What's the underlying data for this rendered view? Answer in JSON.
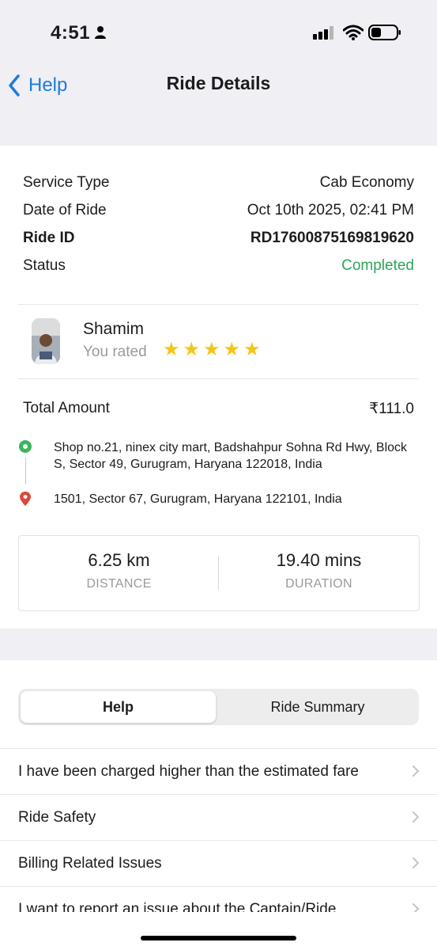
{
  "status_bar": {
    "time": "4:51"
  },
  "nav": {
    "back_label": "Help",
    "title": "Ride Details"
  },
  "ride": {
    "service_type_label": "Service Type",
    "service_type_value": "Cab Economy",
    "date_label": "Date of Ride",
    "date_value": "Oct 10th 2025, 02:41 PM",
    "ride_id_label": "Ride ID",
    "ride_id_value": "RD17600875169819620",
    "status_label": "Status",
    "status_value": "Completed",
    "status_color": "#2ea55a"
  },
  "driver": {
    "name": "Shamim",
    "rated_label": "You rated",
    "rating": 5
  },
  "fare": {
    "label": "Total Amount",
    "value": "₹111.0"
  },
  "route": {
    "pickup": "Shop no.21, ninex city mart, Badshahpur Sohna Rd Hwy, Block S, Sector 49, Gurugram, Haryana 122018, India",
    "drop": "1501, Sector 67, Gurugram, Haryana 122101, India"
  },
  "stats": {
    "distance_value": "6.25 km",
    "distance_label": "DISTANCE",
    "duration_value": "19.40 mins",
    "duration_label": "DURATION"
  },
  "tabs": {
    "help": "Help",
    "summary": "Ride Summary"
  },
  "help_items": [
    "I have been charged higher than the estimated fare",
    "Ride Safety",
    "Billing Related Issues",
    "I want to report an issue about the Captain/Ride"
  ],
  "colors": {
    "accent": "#1f7ae0",
    "star": "#f5c518",
    "background_gray": "#efeff4"
  }
}
